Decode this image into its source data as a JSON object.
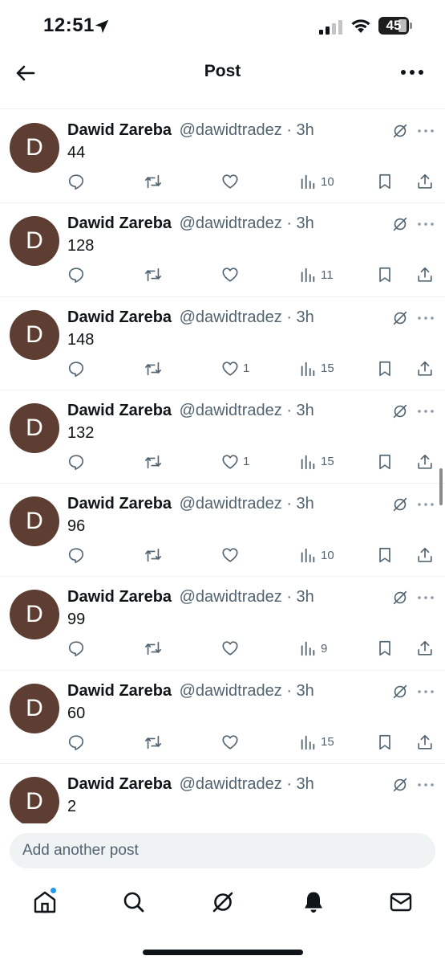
{
  "status_bar": {
    "time": "12:51",
    "battery": "45"
  },
  "header": {
    "title": "Post",
    "back_icon": "arrow-left-icon",
    "more_icon": "more-horizontal-icon"
  },
  "posts": [
    {
      "avatar_initial": "D",
      "name": "Dawid Zareba",
      "handle": "@dawidtradez",
      "time": "3h",
      "text": "44",
      "likes": "",
      "views": "10"
    },
    {
      "avatar_initial": "D",
      "name": "Dawid Zareba",
      "handle": "@dawidtradez",
      "time": "3h",
      "text": "128",
      "likes": "",
      "views": "11"
    },
    {
      "avatar_initial": "D",
      "name": "Dawid Zareba",
      "handle": "@dawidtradez",
      "time": "3h",
      "text": "148",
      "likes": "1",
      "views": "15"
    },
    {
      "avatar_initial": "D",
      "name": "Dawid Zareba",
      "handle": "@dawidtradez",
      "time": "3h",
      "text": "132",
      "likes": "1",
      "views": "15"
    },
    {
      "avatar_initial": "D",
      "name": "Dawid Zareba",
      "handle": "@dawidtradez",
      "time": "3h",
      "text": "96",
      "likes": "",
      "views": "10"
    },
    {
      "avatar_initial": "D",
      "name": "Dawid Zareba",
      "handle": "@dawidtradez",
      "time": "3h",
      "text": "99",
      "likes": "",
      "views": "9"
    },
    {
      "avatar_initial": "D",
      "name": "Dawid Zareba",
      "handle": "@dawidtradez",
      "time": "3h",
      "text": "60",
      "likes": "",
      "views": "15"
    },
    {
      "avatar_initial": "D",
      "name": "Dawid Zareba",
      "handle": "@dawidtradez",
      "time": "3h",
      "text": "2",
      "likes": "",
      "views": ""
    }
  ],
  "composer": {
    "placeholder": "Add another post"
  },
  "bottom_nav": [
    "home-icon",
    "search-icon",
    "grok-icon",
    "notifications-bell-icon",
    "messages-envelope-icon"
  ],
  "colors": {
    "avatar_bg": "#5e3d32",
    "secondary_text": "#536471",
    "accent": "#1d9bf0"
  }
}
